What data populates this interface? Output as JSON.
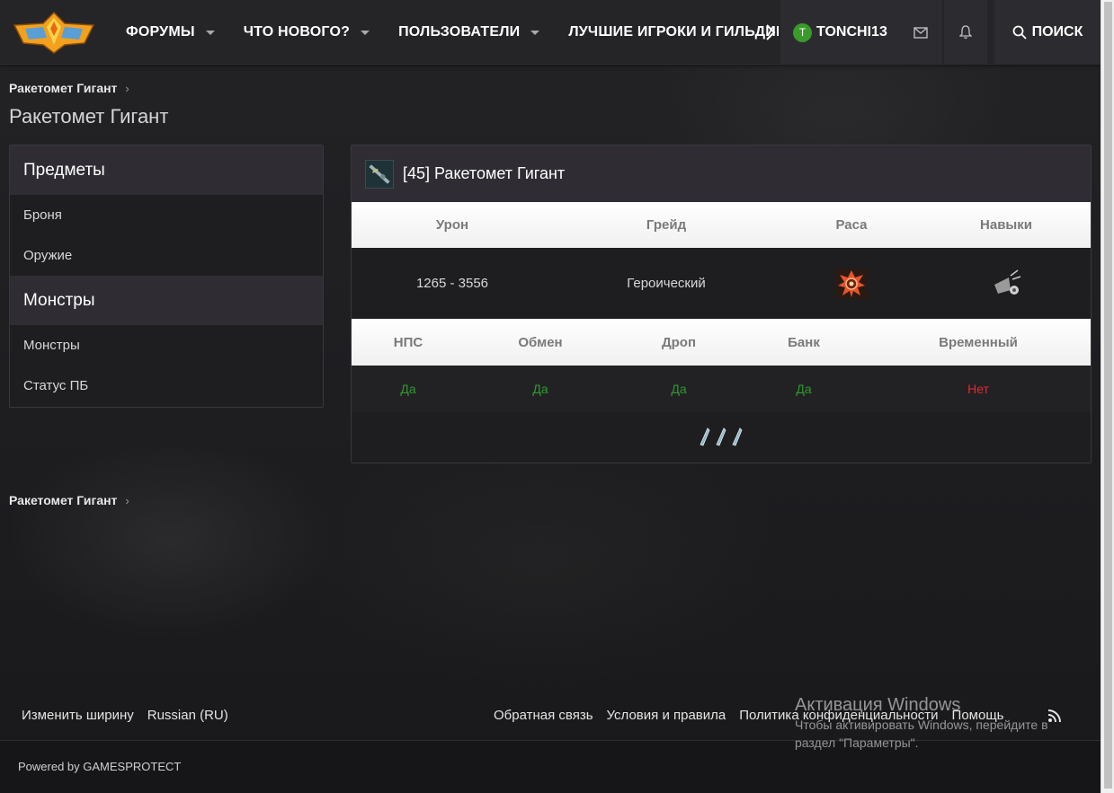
{
  "header": {
    "nav": [
      {
        "label": "ФОРУМЫ",
        "has_dropdown": true
      },
      {
        "label": "ЧТО НОВОГО?",
        "has_dropdown": true
      },
      {
        "label": "ПОЛЬЗОВАТЕЛИ",
        "has_dropdown": true
      },
      {
        "label": "ЛУЧШИЕ ИГРОКИ И ГИЛЬДИИ",
        "has_dropdown": false
      }
    ],
    "user": {
      "initial": "T",
      "name": "TONCHI13"
    },
    "search_label": "ПОИСК"
  },
  "breadcrumb": {
    "top": "Ракетомет Гигант",
    "bottom": "Ракетомет Гигант"
  },
  "page_title": "Ракетомет Гигант",
  "sidebar": {
    "sections": [
      {
        "heading": "Предметы",
        "links": [
          "Броня",
          "Оружие"
        ]
      },
      {
        "heading": "Монстры",
        "links": [
          "Монстры",
          "Статус ПБ"
        ]
      }
    ]
  },
  "item": {
    "title": "[45] Ракетомет Гигант",
    "stats_headers": [
      "Урон",
      "Грейд",
      "Раса",
      "Навыки"
    ],
    "damage": "1265 - 3556",
    "grade": "Героический",
    "flags_headers": [
      "НПС",
      "Обмен",
      "Дроп",
      "Банк",
      "Временный"
    ],
    "flags": [
      {
        "value": "Да",
        "color": "#2f9a2f"
      },
      {
        "value": "Да",
        "color": "#2f9a2f"
      },
      {
        "value": "Да",
        "color": "#2f9a2f"
      },
      {
        "value": "Да",
        "color": "#2f9a2f"
      },
      {
        "value": "Нет",
        "color": "#e02a2a"
      }
    ]
  },
  "footer": {
    "left": [
      "Изменить ширину",
      "Russian (RU)"
    ],
    "right": [
      "Обратная связь",
      "Условия и правила",
      "Политика конфиденциальности",
      "Помощь"
    ],
    "powered": "Powered by GAMESPROTECT"
  },
  "watermark": {
    "title": "Активация Windows",
    "line1": "Чтобы активировать Windows, перейдите в",
    "line2": "раздел \"Параметры\"."
  }
}
